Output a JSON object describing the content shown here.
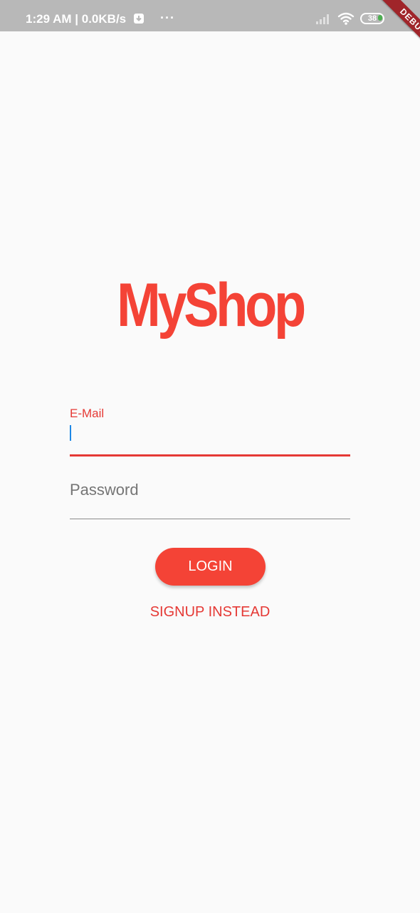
{
  "status_bar": {
    "time_and_speed": "1:29 AM | 0.0KB/s",
    "more_glyph": "···",
    "battery_level": "38",
    "icons": [
      "download-icon",
      "more-icon",
      "signal-icon",
      "wifi-icon",
      "battery-icon"
    ]
  },
  "debug_banner": {
    "label": "DEBUG"
  },
  "app": {
    "logo_text": "MyShop"
  },
  "form": {
    "email_label": "E-Mail",
    "email_value": "",
    "password_placeholder": "Password",
    "password_value": "",
    "login_label": "LOGIN",
    "signup_label": "SIGNUP INSTEAD"
  },
  "colors": {
    "accent": "#f44336",
    "accent_text": "#e53935",
    "caret": "#1e88e5",
    "background": "#fafafa",
    "status_bar": "#b8b8b8"
  }
}
